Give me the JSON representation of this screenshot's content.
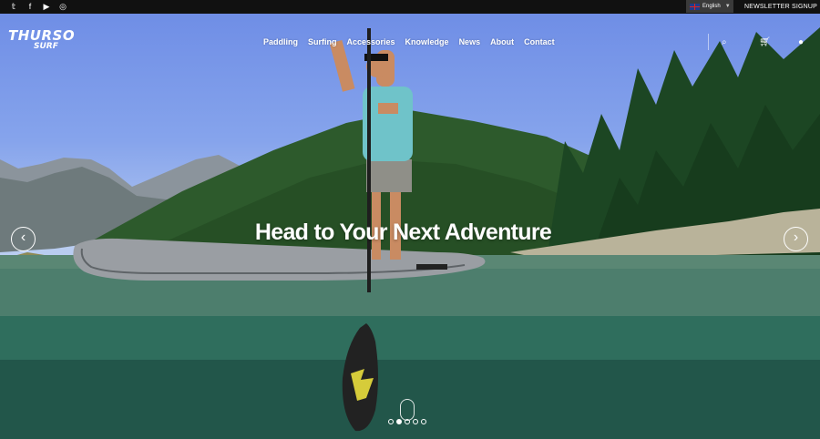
{
  "topbar": {
    "social_icons": [
      "twitter-icon",
      "facebook-icon",
      "youtube-icon",
      "instagram-icon"
    ],
    "social_glyphs": [
      "𝕥",
      "f",
      "▶",
      "◎"
    ],
    "language": "English",
    "newsletter": "NEWSLETTER SIGNUP"
  },
  "logo": {
    "line1": "THURSO",
    "line2": "SURF"
  },
  "nav": [
    "Paddling",
    "Surfing",
    "Accessories",
    "Knowledge",
    "News",
    "About",
    "Contact"
  ],
  "header_icons": [
    "search-icon",
    "cart-icon",
    "user-icon"
  ],
  "hero": {
    "headline": "Head to Your Next Adventure",
    "prev_glyph": "‹",
    "next_glyph": "›",
    "slide_count": 5,
    "active_slide": 2
  },
  "colors": {
    "topbar": "#111111",
    "sky": "#7b98e8",
    "water": "#3f7a6a",
    "forest": "#1f4d28"
  }
}
